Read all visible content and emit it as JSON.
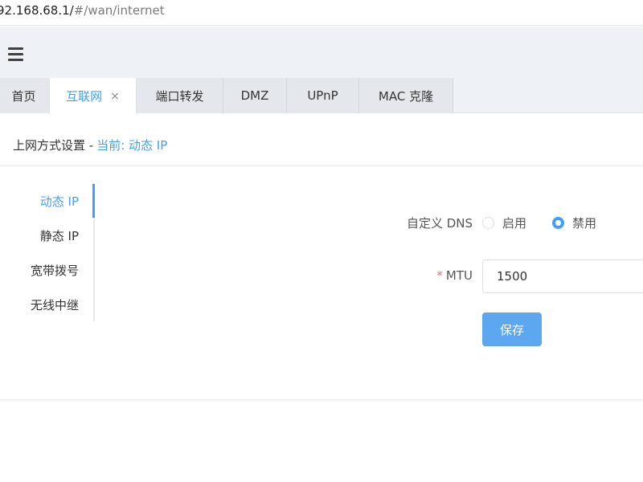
{
  "browser": {
    "url_host": "92.168.68.1/",
    "url_path": "#/wan/internet"
  },
  "topbar": {
    "menu_icon": "hamburger-menu-icon"
  },
  "tabs": [
    {
      "label": "首页",
      "active": false
    },
    {
      "label": "互联网",
      "active": true,
      "close": "×"
    },
    {
      "label": "端口转发",
      "active": false
    },
    {
      "label": "DMZ",
      "active": false
    },
    {
      "label": "UPnP",
      "active": false
    },
    {
      "label": "MAC 克隆",
      "active": false
    }
  ],
  "header": {
    "title": "上网方式设置 - ",
    "current": "当前: 动态 IP"
  },
  "sidenav": {
    "items": [
      {
        "label": "动态 IP",
        "active": true
      },
      {
        "label": "静态 IP",
        "active": false
      },
      {
        "label": "宽带拨号",
        "active": false
      },
      {
        "label": "无线中继",
        "active": false
      }
    ]
  },
  "form": {
    "dns_label": "自定义 DNS",
    "dns_options": [
      {
        "label": "启用",
        "checked": false
      },
      {
        "label": "禁用",
        "checked": true
      }
    ],
    "mtu_required": "*",
    "mtu_label": "MTU",
    "mtu_value": "1500",
    "save_label": "保存"
  },
  "colors": {
    "accent": "#409eff",
    "button": "#5ca7f0",
    "required": "#f56c6c"
  }
}
